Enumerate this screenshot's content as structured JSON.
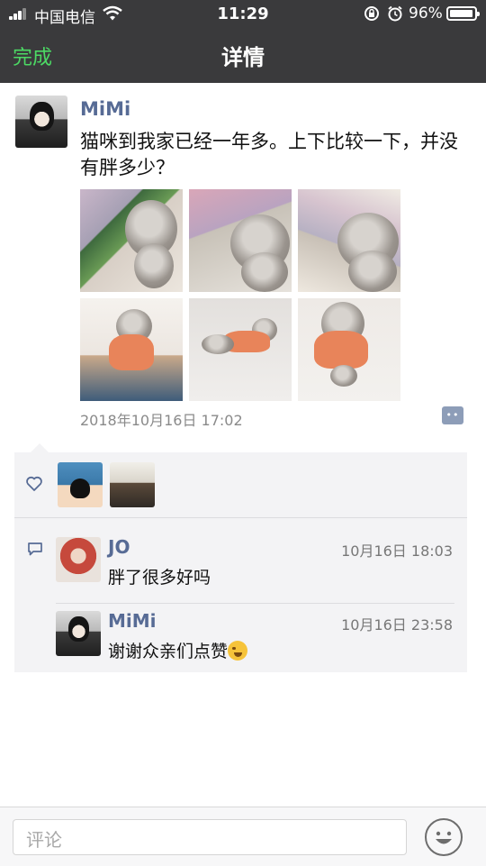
{
  "status_bar": {
    "carrier": "中国电信",
    "time": "11:29",
    "battery_percent": "96%",
    "battery_level": 0.96
  },
  "nav": {
    "done_label": "完成",
    "title": "详情"
  },
  "post": {
    "author": "MiMi",
    "text": "猫咪到我家已经一年多。上下比较一下，并没有胖多少？",
    "photo_count": 6,
    "timestamp": "2018年10月16日 17:02"
  },
  "likes": {
    "avatars": [
      "cartoon-avatar",
      "group-photo-avatar"
    ]
  },
  "comments": [
    {
      "name": "JO",
      "time": "10月16日 18:03",
      "text": "胖了很多好吗"
    },
    {
      "name": "MiMi",
      "time": "10月16日 23:58",
      "text": "谢谢众亲们点赞"
    }
  ],
  "comment_input": {
    "placeholder": "评论"
  },
  "colors": {
    "nav_bg": "#3a3a3c",
    "done_green": "#4cd964",
    "name_blue": "#576b95",
    "panel_bg": "#f3f3f5"
  }
}
